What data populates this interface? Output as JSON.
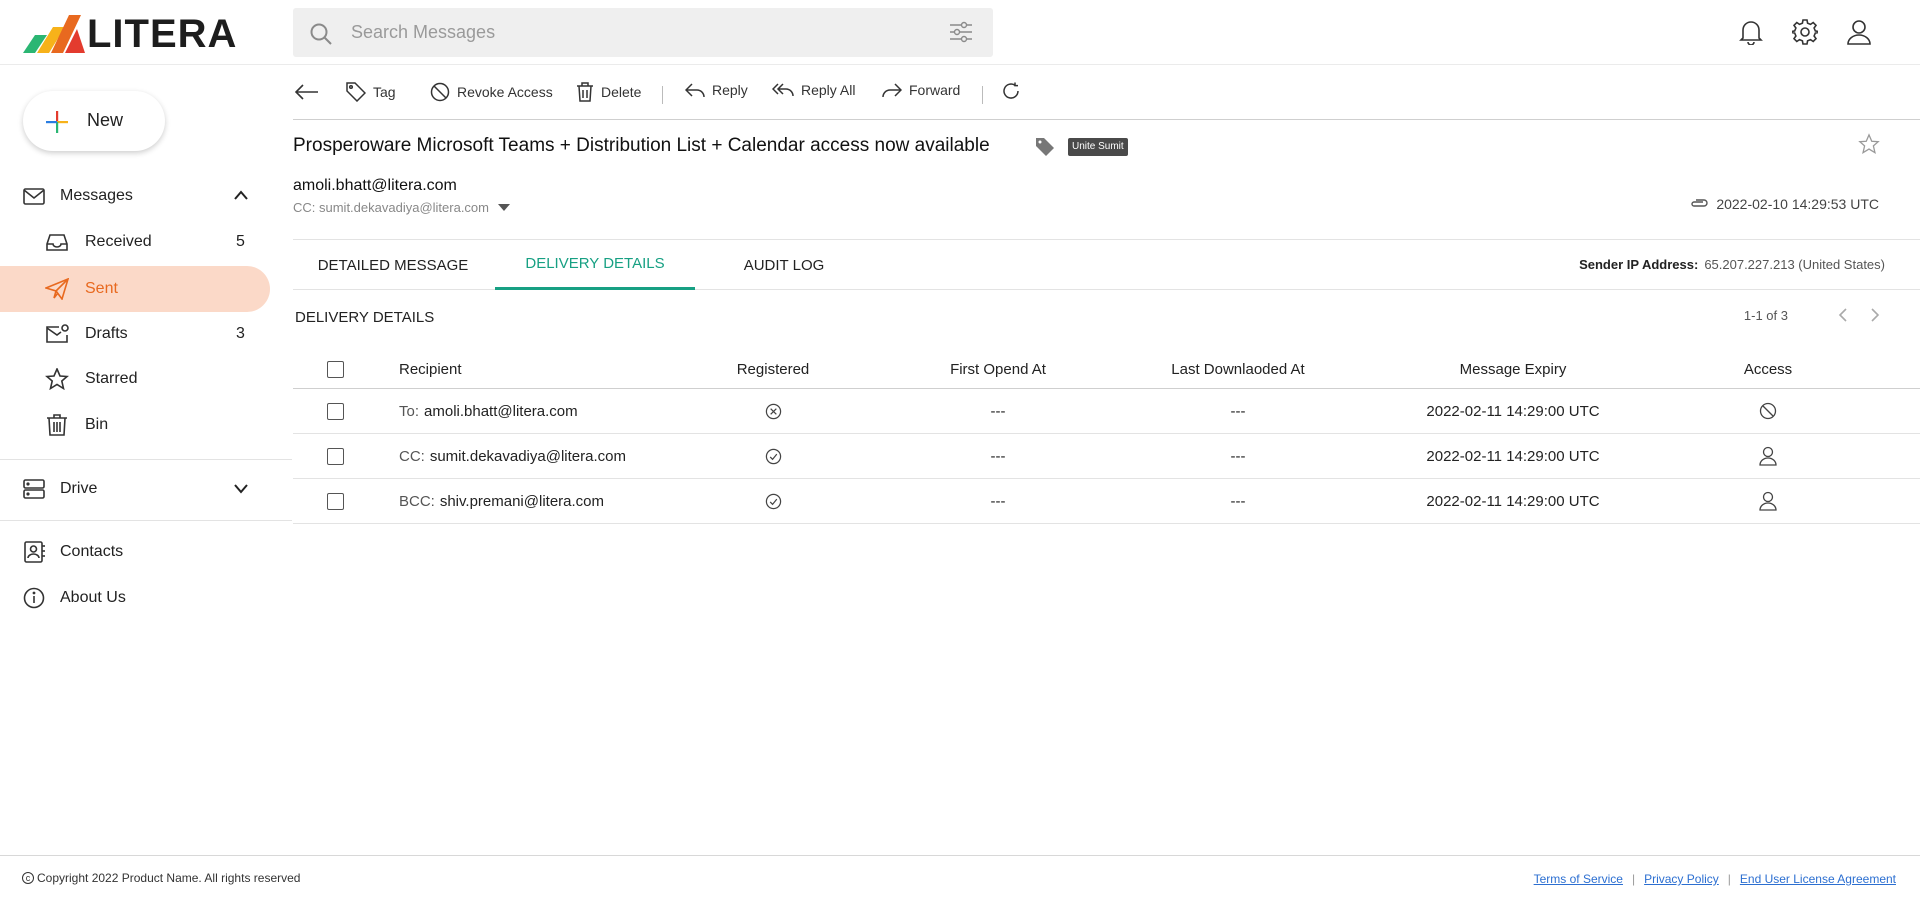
{
  "app": {
    "brand": "LITERA",
    "colors": {
      "accent": "#e8691f",
      "active_bg": "#fbd9c8",
      "tab_active": "#17a083",
      "link": "#2c6fd1"
    }
  },
  "search": {
    "placeholder": "Search Messages",
    "value": ""
  },
  "topbar_icons": [
    "bell-icon",
    "gear-icon",
    "user-icon"
  ],
  "sidebar": {
    "new_label": "New",
    "messages_label": "Messages",
    "items": [
      {
        "label": "Received",
        "count": "5",
        "icon": "inbox-icon"
      },
      {
        "label": "Sent",
        "count": "",
        "icon": "send-icon",
        "active": true
      },
      {
        "label": "Drafts",
        "count": "3",
        "icon": "draft-icon"
      },
      {
        "label": "Starred",
        "count": "",
        "icon": "star-icon"
      },
      {
        "label": "Bin",
        "count": "",
        "icon": "trash-icon"
      }
    ],
    "drive_label": "Drive",
    "contacts_label": "Contacts",
    "about_label": "About Us"
  },
  "toolbar": {
    "tag": "Tag",
    "revoke": "Revoke Access",
    "delete": "Delete",
    "reply": "Reply",
    "reply_all": "Reply All",
    "forward": "Forward"
  },
  "message": {
    "subject": "Prosperoware Microsoft Teams + Distribution List + Calendar access now available",
    "tag_badge": "Unite Sumit",
    "from": "amoli.bhatt@litera.com",
    "cc": "CC: sumit.dekavadiya@litera.com",
    "datetime": "2022-02-10 14:29:53 UTC"
  },
  "tabs": {
    "detailed": "DETAILED MESSAGE",
    "delivery": "DELIVERY DETAILS",
    "audit": "AUDIT LOG",
    "active": "delivery"
  },
  "sender_ip": {
    "label": "Sender IP Address:",
    "value": "65.207.227.213 (United States)"
  },
  "delivery": {
    "title": "DELIVERY DETAILS",
    "pager": "1-1 of 3",
    "columns": {
      "recipient": "Recipient",
      "registered": "Registered",
      "first_opened": "First Opend At",
      "last_downloaded": "Last Downlaoded At",
      "expiry": "Message Expiry",
      "access": "Access"
    },
    "rows": [
      {
        "type": "To:",
        "email": "amoli.bhatt@litera.com",
        "registered": "no",
        "first_opened": "---",
        "last_downloaded": "---",
        "expiry": "2022-02-11 14:29:00 UTC",
        "access": "blocked"
      },
      {
        "type": "CC:",
        "email": "sumit.dekavadiya@litera.com",
        "registered": "yes",
        "first_opened": "---",
        "last_downloaded": "---",
        "expiry": "2022-02-11 14:29:00 UTC",
        "access": "user"
      },
      {
        "type": "BCC:",
        "email": "shiv.premani@litera.com",
        "registered": "yes",
        "first_opened": "---",
        "last_downloaded": "---",
        "expiry": "2022-02-11 14:29:00 UTC",
        "access": "user"
      }
    ]
  },
  "footer": {
    "copyright": "Copyright 2022 Product Name. All rights reserved",
    "terms": "Terms of Service",
    "privacy": "Privacy Policy",
    "eula": "End User License Agreement"
  }
}
